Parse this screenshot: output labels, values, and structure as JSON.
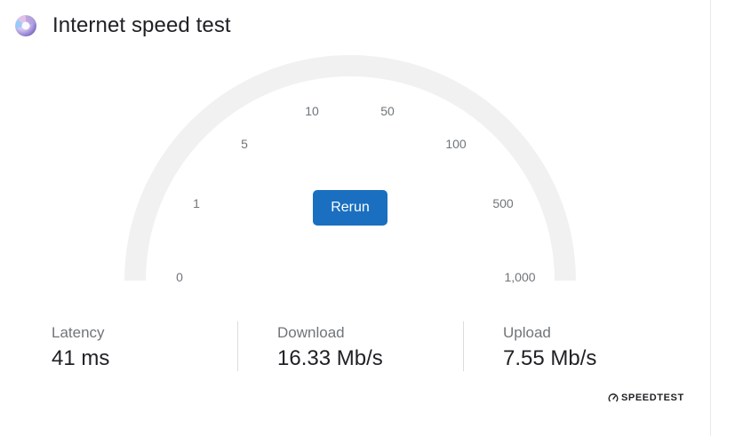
{
  "header": {
    "title": "Internet speed test",
    "icon": "speedtest-app-icon"
  },
  "gauge": {
    "ticks": [
      "0",
      "1",
      "5",
      "10",
      "50",
      "100",
      "500",
      "1,000"
    ],
    "track_color": "#f1f1f1"
  },
  "actions": {
    "rerun_label": "Rerun",
    "rerun_color": "#1a6fc0"
  },
  "stats": {
    "latency": {
      "label": "Latency",
      "value": "41 ms"
    },
    "download": {
      "label": "Download",
      "value": "16.33 Mb/s"
    },
    "upload": {
      "label": "Upload",
      "value": "7.55 Mb/s"
    }
  },
  "brand": {
    "name": "SPEEDTEST",
    "icon": "speedtest-gauge-icon"
  }
}
